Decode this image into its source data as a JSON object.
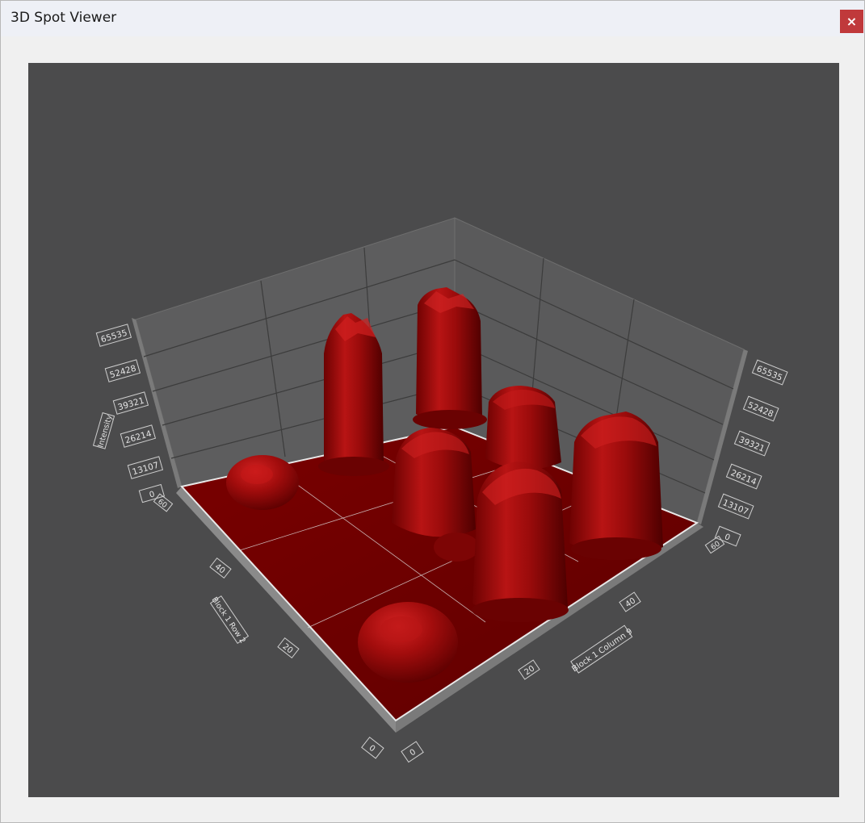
{
  "window": {
    "title": "3D Spot Viewer",
    "close_label": "×"
  },
  "chart_data": {
    "type": "surface3d",
    "z_axis": {
      "title": "Intensity",
      "ticks": [
        "0",
        "13107",
        "26214",
        "39321",
        "52428",
        "65535"
      ],
      "range": [
        0,
        65535
      ]
    },
    "x_axis": {
      "title": "Block 1 Column 9",
      "ticks": [
        "0",
        "20",
        "40",
        "60"
      ]
    },
    "y_axis": {
      "title": "Block 1 Row 2",
      "ticks": [
        "0",
        "20",
        "40",
        "60"
      ]
    },
    "surface_color": "#8b0000",
    "background_color": "#4b4b4c",
    "spots": [
      {
        "name": "spot-low-back-left",
        "peak": 7000
      },
      {
        "name": "spot-tall-back",
        "peak": 57000
      },
      {
        "name": "spot-tallest-back-right",
        "peak": 62000
      },
      {
        "name": "spot-mid-center",
        "peak": 34000
      },
      {
        "name": "spot-mid-right",
        "peak": 40000
      },
      {
        "name": "spot-front-center",
        "peak": 45000
      },
      {
        "name": "spot-right",
        "peak": 43000
      },
      {
        "name": "spot-low-front",
        "peak": 9000
      }
    ]
  }
}
